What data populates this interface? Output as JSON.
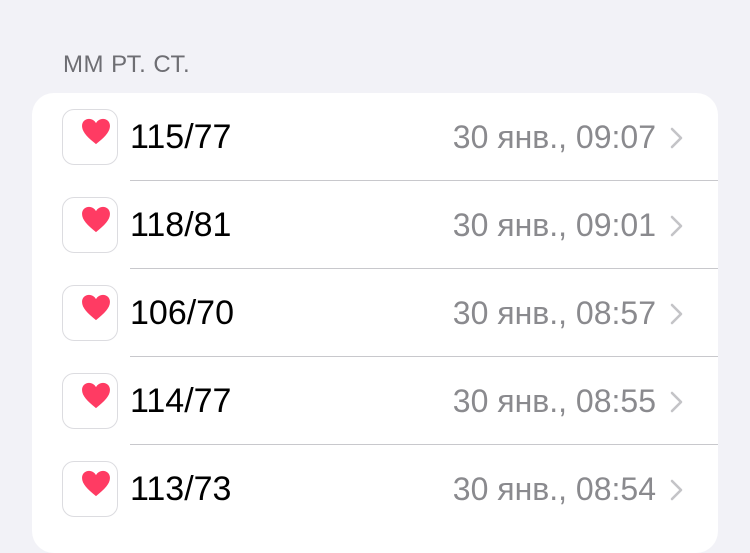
{
  "section": {
    "header": "ММ РТ. СТ."
  },
  "colors": {
    "heart": "#ff3b63",
    "background": "#f2f2f7"
  },
  "rows": [
    {
      "icon": "heart-icon",
      "value": "115/77",
      "datetime": "30 янв., 09:07"
    },
    {
      "icon": "heart-icon",
      "value": "118/81",
      "datetime": "30 янв., 09:01"
    },
    {
      "icon": "heart-icon",
      "value": "106/70",
      "datetime": "30 янв., 08:57"
    },
    {
      "icon": "heart-icon",
      "value": "114/77",
      "datetime": "30 янв., 08:55"
    },
    {
      "icon": "heart-icon",
      "value": "113/73",
      "datetime": "30 янв., 08:54"
    }
  ]
}
